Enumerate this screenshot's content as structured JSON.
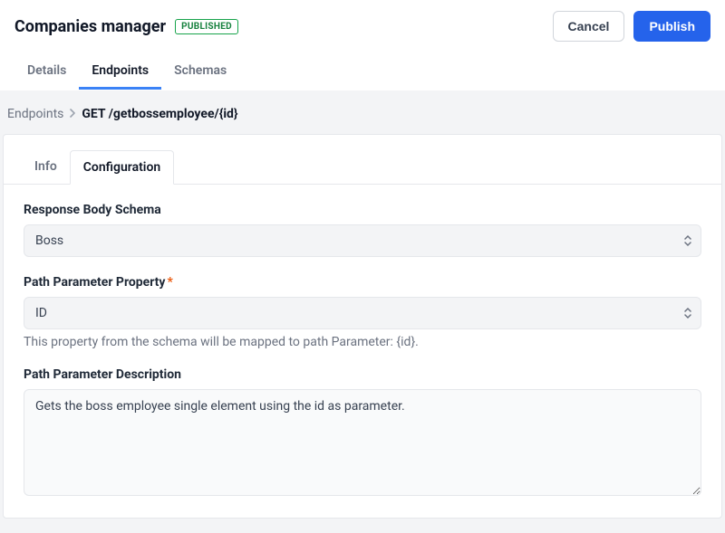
{
  "header": {
    "title": "Companies manager",
    "badge": "PUBLISHED",
    "cancel_label": "Cancel",
    "publish_label": "Publish"
  },
  "tabs": {
    "details": "Details",
    "endpoints": "Endpoints",
    "schemas": "Schemas"
  },
  "breadcrumb": {
    "root": "Endpoints",
    "current": "GET /getbossemployee/{id}"
  },
  "subtabs": {
    "info": "Info",
    "configuration": "Configuration"
  },
  "form": {
    "response_body_schema_label": "Response Body Schema",
    "response_body_schema_value": "Boss",
    "path_param_property_label": "Path Parameter Property",
    "path_param_property_value": "ID",
    "path_param_property_help": "This property from the schema will be mapped to path Parameter: {id}.",
    "path_param_description_label": "Path Parameter Description",
    "path_param_description_value": "Gets the boss employee single element using the id as parameter."
  }
}
